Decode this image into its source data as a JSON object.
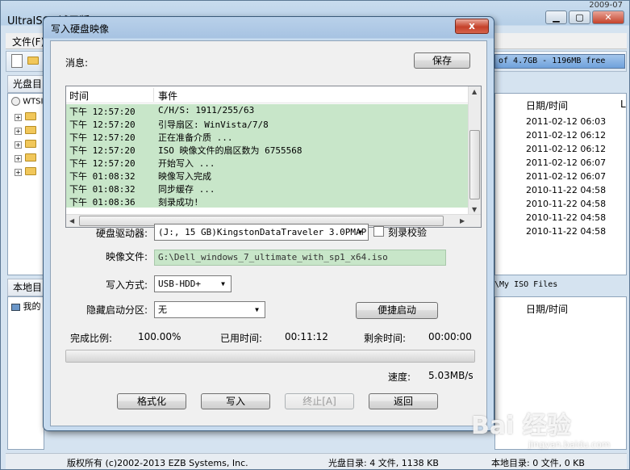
{
  "main_window": {
    "title": "UltraISO (试用版) - C:\\Dell_windows_7_ultimate_with_sp1_x64.iso",
    "corner_date": "2009-07",
    "menu_file": "文件(F)",
    "size_bar": "of 4.7GB - 1196MB free",
    "cd_dir_tab": "光盘目",
    "local_dir_tab": "本地目",
    "tree_root": "WTSI",
    "local_root": "我的",
    "date_col": "日期/时间",
    "date_col2": "日期/时间",
    "date_list": [
      "2011-02-12 06:03",
      "2011-02-12 06:12",
      "2011-02-12 06:12",
      "2011-02-12 06:07",
      "2011-02-12 06:07",
      "2010-11-22 04:58",
      "2010-11-22 04:58",
      "2010-11-22 04:58",
      "2010-11-22 04:58"
    ],
    "local_path": "s\\My ISO Files",
    "status_copyright": "版权所有 (c)2002-2013 EZB Systems, Inc.",
    "status_cd": "光盘目录: 4 文件, 1138 KB",
    "status_local": "本地目录: 0 文件, 0 KB"
  },
  "dialog": {
    "title": "写入硬盘映像",
    "close_label": "x",
    "messages_label": "消息:",
    "save_label": "保存",
    "log_headers": {
      "time": "时间",
      "event": "事件"
    },
    "log_rows": [
      {
        "time": "下午 12:57:20",
        "event": "C/H/S: 1911/255/63"
      },
      {
        "time": "下午 12:57:20",
        "event": "引导扇区: WinVista/7/8"
      },
      {
        "time": "下午 12:57:20",
        "event": "正在准备介质 ..."
      },
      {
        "time": "下午 12:57:20",
        "event": "ISO 映像文件的扇区数为 6755568"
      },
      {
        "time": "下午 12:57:20",
        "event": "开始写入 ..."
      },
      {
        "time": "下午 01:08:32",
        "event": "映像写入完成"
      },
      {
        "time": "下午 01:08:32",
        "event": "同步缓存 ..."
      },
      {
        "time": "下午 01:08:36",
        "event": "刻录成功!"
      }
    ],
    "drive_label": "硬盘驱动器:",
    "drive_value": "(J:, 15 GB)KingstonDataTraveler 3.0PMAP",
    "verify_label": "刻录校验",
    "image_label": "映像文件:",
    "image_value": "G:\\Dell_windows_7_ultimate_with_sp1_x64.iso",
    "write_mode_label": "写入方式:",
    "write_mode_value": "USB-HDD+",
    "hidden_boot_label": "隐藏启动分区:",
    "hidden_boot_value": "无",
    "quick_boot_label": "便捷启动",
    "progress_label": "完成比例:",
    "progress_value": "100.00%",
    "progress_fraction": 1.0,
    "elapsed_label": "已用时间:",
    "elapsed_value": "00:11:12",
    "remaining_label": "剩余时间:",
    "remaining_value": "00:00:00",
    "speed_label": "速度:",
    "speed_value": "5.03MB/s",
    "format_label": "格式化",
    "write_label": "写入",
    "stop_label": "终止[A]",
    "back_label": "返回"
  },
  "watermark": {
    "brand": "Bai 经验",
    "url": "jingyan.baidu.com"
  }
}
